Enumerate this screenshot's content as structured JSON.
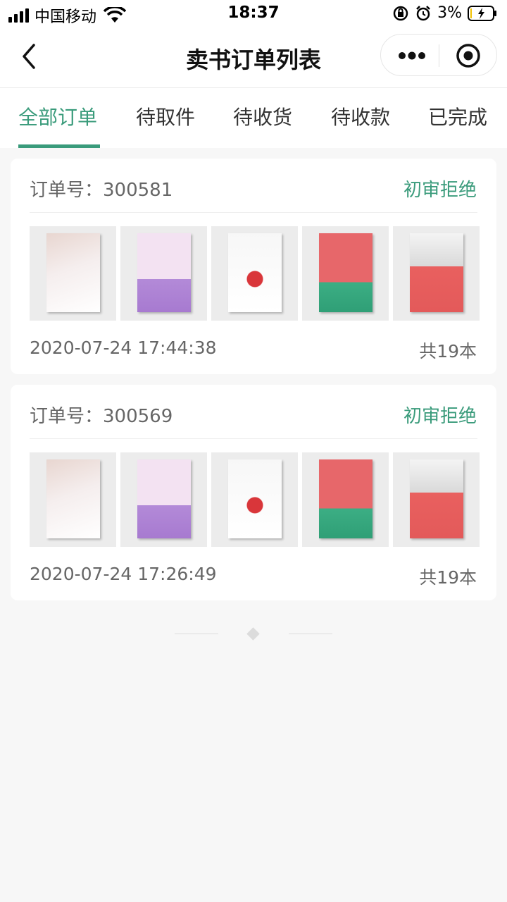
{
  "status_bar": {
    "carrier": "中国移动",
    "time": "18:37",
    "battery": "3%"
  },
  "nav": {
    "title": "卖书订单列表",
    "accent_color": "#3a9b7b"
  },
  "tabs": [
    {
      "label": "全部订单",
      "active": true
    },
    {
      "label": "待取件",
      "active": false
    },
    {
      "label": "待收货",
      "active": false
    },
    {
      "label": "待收款",
      "active": false
    },
    {
      "label": "已完成",
      "active": false
    }
  ],
  "orders": [
    {
      "order_label": "订单号：300581",
      "status": "初审拒绝",
      "time": "2020-07-24 17:44:38",
      "count": "共19本",
      "book_colors": [
        "#f1e3e3",
        "#b38ad8",
        "#f7f7f7",
        "#e7676a",
        "#f2f2f2"
      ]
    },
    {
      "order_label": "订单号：300569",
      "status": "初审拒绝",
      "time": "2020-07-24 17:26:49",
      "count": "共19本",
      "book_colors": [
        "#f1e3e3",
        "#b38ad8",
        "#f7f7f7",
        "#e7676a",
        "#f2f2f2"
      ]
    }
  ]
}
